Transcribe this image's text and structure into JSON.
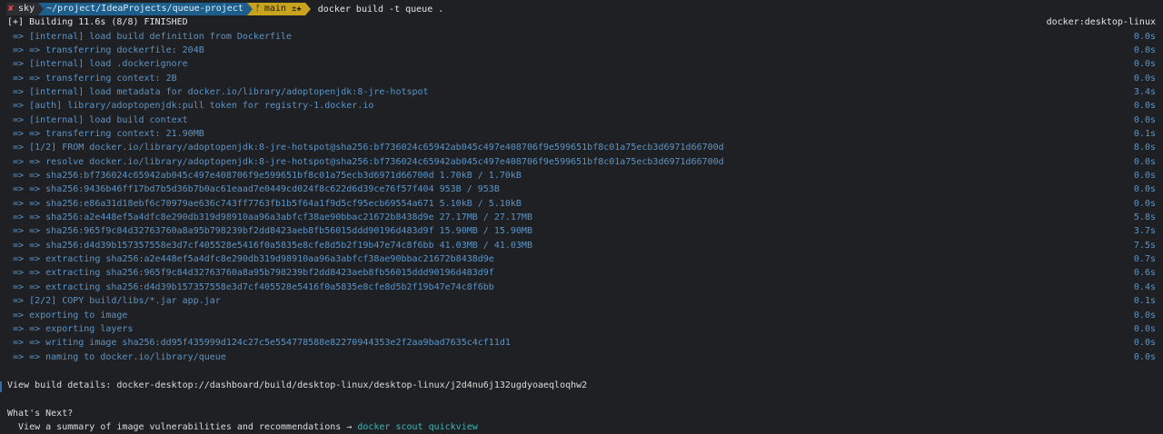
{
  "prompt": {
    "status_icon": "✘",
    "user": "sky",
    "path": "~/project/IdeaProjects/queue-project",
    "git_branch_icon": "ᚠ",
    "git_branch": "main",
    "git_dirty": "±✚",
    "command": "docker build -t queue ."
  },
  "build": {
    "header": "[+] Building 11.6s (8/8) FINISHED",
    "platform": "docker:desktop-linux",
    "steps": [
      {
        "text": " => [internal] load build definition from Dockerfile",
        "time": "0.0s"
      },
      {
        "text": " => => transferring dockerfile: 204B",
        "time": "0.0s"
      },
      {
        "text": " => [internal] load .dockerignore",
        "time": "0.0s"
      },
      {
        "text": " => => transferring context: 2B",
        "time": "0.0s"
      },
      {
        "text": " => [internal] load metadata for docker.io/library/adoptopenjdk:8-jre-hotspot",
        "time": "3.4s"
      },
      {
        "text": " => [auth] library/adoptopenjdk:pull token for registry-1.docker.io",
        "time": "0.0s"
      },
      {
        "text": " => [internal] load build context",
        "time": "0.0s"
      },
      {
        "text": " => => transferring context: 21.90MB",
        "time": "0.1s"
      },
      {
        "text": " => [1/2] FROM docker.io/library/adoptopenjdk:8-jre-hotspot@sha256:bf736024c65942ab045c497e408706f9e599651bf8c01a75ecb3d6971d66700d",
        "time": "8.0s"
      },
      {
        "text": " => => resolve docker.io/library/adoptopenjdk:8-jre-hotspot@sha256:bf736024c65942ab045c497e408706f9e599651bf8c01a75ecb3d6971d66700d",
        "time": "0.0s"
      },
      {
        "text": " => => sha256:bf736024c65942ab045c497e408706f9e599651bf8c01a75ecb3d6971d66700d 1.70kB / 1.70kB",
        "time": "0.0s"
      },
      {
        "text": " => => sha256:9436b46ff17bd7b5d36b7b0ac61eaad7e0449cd024f8c622d6d39ce76f57f404 953B / 953B",
        "time": "0.0s"
      },
      {
        "text": " => => sha256:e86a31d18ebf6c70979ae636c743ff7763fb1b5f64a1f9d5cf95ecb69554a671 5.10kB / 5.10kB",
        "time": "0.0s"
      },
      {
        "text": " => => sha256:a2e448ef5a4dfc8e290db319d98910aa96a3abfcf38ae90bbac21672b8438d9e 27.17MB / 27.17MB",
        "time": "5.8s"
      },
      {
        "text": " => => sha256:965f9c84d32763760a8a95b798239bf2dd8423aeb8fb56015ddd90196d483d9f 15.90MB / 15.90MB",
        "time": "3.7s"
      },
      {
        "text": " => => sha256:d4d39b157357558e3d7cf405528e5416f0a5835e8cfe8d5b2f19b47e74c8f6bb 41.03MB / 41.03MB",
        "time": "7.5s"
      },
      {
        "text": " => => extracting sha256:a2e448ef5a4dfc8e290db319d98910aa96a3abfcf38ae90bbac21672b8438d9e",
        "time": "0.7s"
      },
      {
        "text": " => => extracting sha256:965f9c84d32763760a8a95b798239bf2dd8423aeb8fb56015ddd90196d483d9f",
        "time": "0.6s"
      },
      {
        "text": " => => extracting sha256:d4d39b157357558e3d7cf405528e5416f0a5835e8cfe8d5b2f19b47e74c8f6bb",
        "time": "0.4s"
      },
      {
        "text": " => [2/2] COPY build/libs/*.jar app.jar",
        "time": "0.1s"
      },
      {
        "text": " => exporting to image",
        "time": "0.0s"
      },
      {
        "text": " => => exporting layers",
        "time": "0.0s"
      },
      {
        "text": " => => writing image sha256:dd95f435999d124c27c5e554778588e82270944353e2f2aa9bad7635c4cf11d1",
        "time": "0.0s"
      },
      {
        "text": " => => naming to docker.io/library/queue",
        "time": "0.0s"
      }
    ]
  },
  "details": {
    "text": "View build details: docker-desktop://dashboard/build/desktop-linux/desktop-linux/j2d4nu6j132ugdyoaeqloqhw2"
  },
  "next": {
    "heading": "What's Next?",
    "summary_prefix": "  View a summary of image vulnerabilities and recommendations → ",
    "summary_command": "docker scout quickview"
  }
}
